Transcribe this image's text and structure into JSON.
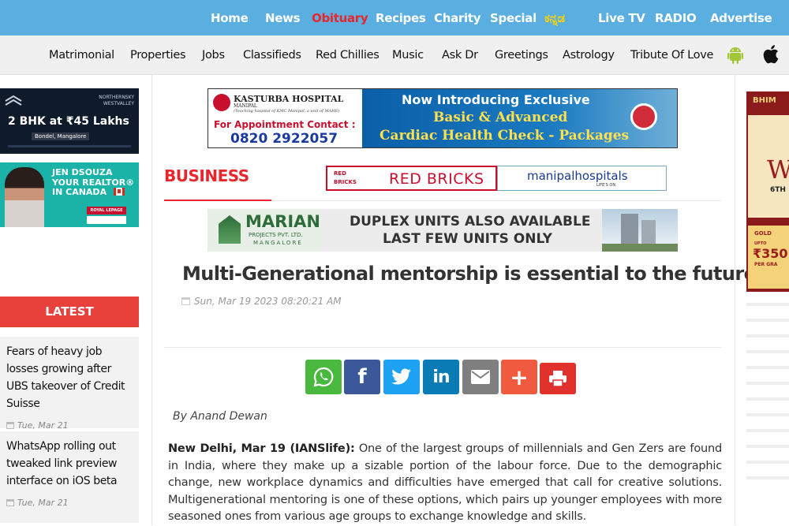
{
  "topnav": [
    "Home",
    "News",
    "Obituary",
    "Recipes",
    "Charity",
    "Special",
    "ಕನ್ನಡ",
    "Live TV",
    "RADIO",
    "Advertise"
  ],
  "topnav_active": "Obituary",
  "subnav": [
    "Matrimonial",
    "Properties",
    "Jobs",
    "Classifieds",
    "Red Chillies",
    "Music",
    "Ask Dr",
    "Greetings",
    "Astrology",
    "Tribute Of Love"
  ],
  "left_ads": {
    "northernsky": {
      "brand": "NORTHERNSKY WESTVALLEY",
      "line": "2 BHK at ₹45 Lakhs",
      "loc": "Bondel, Mangalore"
    },
    "realtor": {
      "line1": "JEN DSOUZA",
      "line2": "YOUR REALTOR®",
      "line3": "IN CANADA",
      "brand": "ROYAL LEPAGE"
    }
  },
  "latest": {
    "title": "LATEST",
    "items": [
      {
        "title": "Fears of heavy job losses growing after UBS takeover of Credit Suisse",
        "date": "Tue, Mar 21"
      },
      {
        "title": "WhatsApp rolling out tweaked link preview interface on iOS beta",
        "date": "Tue, Mar 21"
      }
    ]
  },
  "ads": {
    "kasturba": {
      "name": "KASTURBA HOSPITAL",
      "sub": "MANIPAL",
      "note": "(Teaching hospital of KMC Manipal, a unit of MAHE)",
      "contact_label": "For Appointment Contact :",
      "phone": "0820 2922057",
      "headline": "Now Introducing Exclusive",
      "line2": "Basic & Advanced",
      "line3": "Cardiac Health Check - Packages"
    },
    "redbricks": {
      "logo": "RED BRICKS",
      "text": "RED BRICKS"
    },
    "manipal": {
      "text": "manipalhospitals",
      "sub": "LIFE'S ON"
    },
    "marian": {
      "name": "MARIAN",
      "sub": "PROJECTS PVT. LTD.",
      "city": "MANGALORE",
      "line1": "DUPLEX UNITS ALSO AVAILABLE",
      "line2": "LAST FEW UNITS ONLY"
    },
    "bhima": {
      "brand": "BHIM",
      "big": "W",
      "date": "6TH",
      "gold": "GOLD",
      "upto": "UPTO",
      "price": "₹350",
      "per": "PER GRA"
    }
  },
  "article": {
    "section": "BUSINESS",
    "headline": "Multi-Generational mentorship is essential to the future",
    "date": "Sun, Mar 19 2023 08:20:21 AM",
    "byline": "By Anand Dewan",
    "dateline": "New Delhi, Mar 19 (IANSlife):",
    "body": " One of the largest groups of millennials and Gen Zers are found in India, where they make up a sizable portion of the labour force. Due to the demographic change, new workplace dynamics and difficulties have emerged that call for creative solutions. Multigenerational mentoring is one of these options, which pairs up younger employees with more seasoned ones from various age groups to exchange knowledge and skills."
  },
  "share_buttons": [
    {
      "name": "whatsapp",
      "color": "#48b83f"
    },
    {
      "name": "facebook",
      "color": "#3b5998"
    },
    {
      "name": "twitter",
      "color": "#1da1f2"
    },
    {
      "name": "linkedin",
      "color": "#0a7bb4"
    },
    {
      "name": "email",
      "color": "#7f7f7f"
    },
    {
      "name": "more",
      "color": "#f05a3e"
    },
    {
      "name": "print",
      "color": "#e0312d"
    }
  ]
}
